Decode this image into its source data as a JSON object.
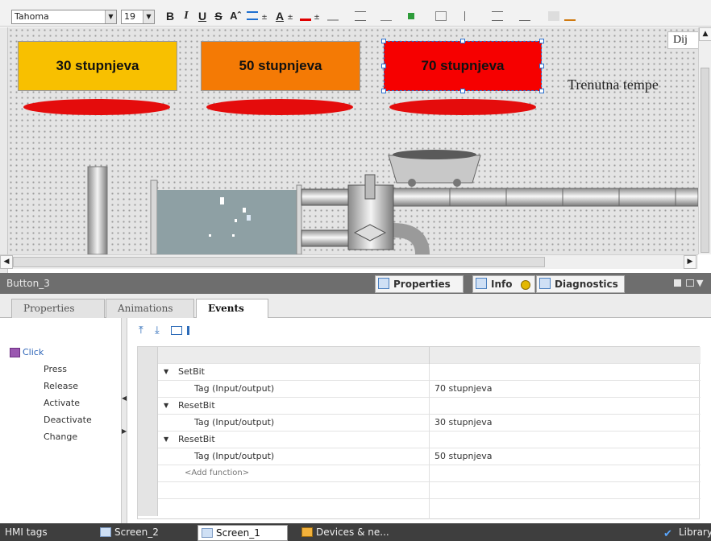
{
  "toolbar": {
    "font_name": "Tahoma",
    "font_size": "19",
    "bold_label": "B",
    "italic_label": "I",
    "underline_label": "U",
    "strike_label": "S",
    "superscript_label": "Aˆ",
    "font_color_label": "A"
  },
  "screen": {
    "buttons": [
      {
        "label": "30 stupnjeva",
        "color": "#f8c000"
      },
      {
        "label": "50 stupnjeva",
        "color": "#f47a05"
      },
      {
        "label": "70 stupnjeva",
        "color": "#f60000"
      }
    ],
    "indicator_color": "#e40c0c",
    "trenutna_text": "Trenutna tempe",
    "dij_text": "Dij"
  },
  "properties_bar": {
    "title": "Button_3",
    "tabs": [
      "Properties",
      "Info",
      "Diagnostics"
    ]
  },
  "subtabs": [
    "Properties",
    "Animations",
    "Events"
  ],
  "events": {
    "items": [
      "Click",
      "Press",
      "Release",
      "Activate",
      "Deactivate",
      "Change"
    ],
    "selected": "Click"
  },
  "functions_grid": {
    "rows": [
      {
        "name": "SetBit",
        "param": "",
        "value": ""
      },
      {
        "name": "",
        "param": "Tag (Input/output)",
        "value": "70 stupnjeva"
      },
      {
        "name": "ResetBit",
        "param": "",
        "value": ""
      },
      {
        "name": "",
        "param": "Tag (Input/output)",
        "value": "30 stupnjeva"
      },
      {
        "name": "ResetBit",
        "param": "",
        "value": ""
      },
      {
        "name": "",
        "param": "Tag (Input/output)",
        "value": "50 stupnjeva"
      },
      {
        "name": "<Add function>",
        "param": "",
        "value": ""
      }
    ]
  },
  "taskbar": {
    "items": [
      "HMI tags",
      "Screen_2",
      "Screen_1",
      "Devices & ne...",
      "Library"
    ],
    "active": "Screen_1"
  }
}
